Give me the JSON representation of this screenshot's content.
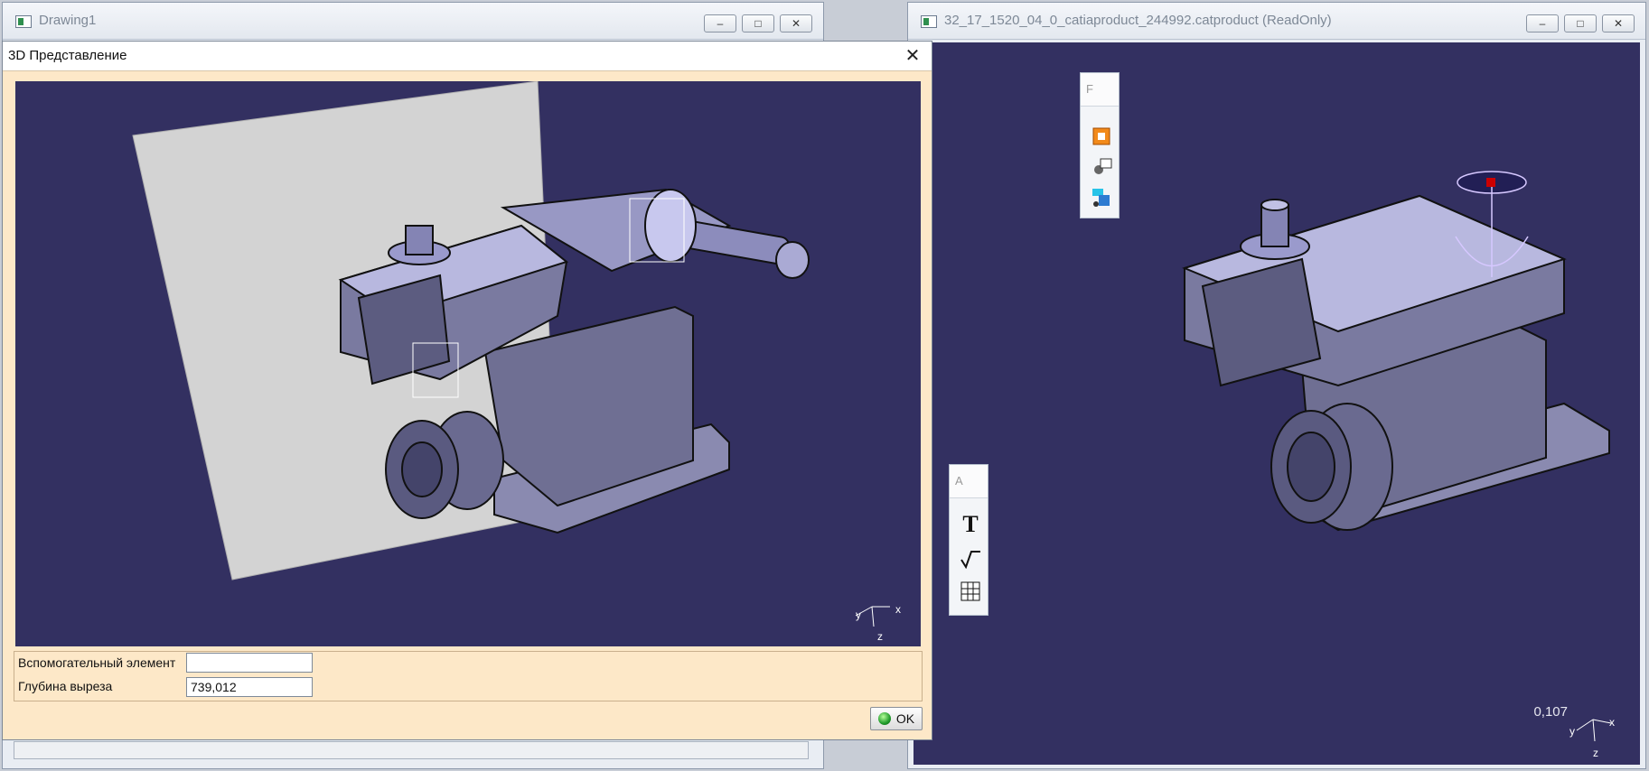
{
  "left_window": {
    "title": "Drawing1",
    "minimize_label": "–",
    "maximize_label": "□",
    "close_label": "✕"
  },
  "right_window": {
    "title": "32_17_1520_04_0_catiaproduct_244992.catproduct (ReadOnly)",
    "minimize_label": "–",
    "maximize_label": "□",
    "close_label": "✕",
    "zoom_value": "0,107"
  },
  "dialog": {
    "title": "3D Представление",
    "close_label": "✕",
    "aux_element_label": "Вспомогательный элемент",
    "aux_element_value": "",
    "cut_depth_label": "Глубина выреза",
    "cut_depth_value": "739,012",
    "ok_label": "OK"
  },
  "toolbars": {
    "top_header": "F",
    "bottom_header": "A",
    "text_tool_label": "T"
  },
  "axes": {
    "x": "x",
    "y": "y",
    "z": "z"
  },
  "colors": {
    "viewport_bg": "#333061",
    "dialog_bg": "#fde8c8",
    "part_fill": "#6f6f93",
    "part_highlight": "#b8b8df"
  }
}
